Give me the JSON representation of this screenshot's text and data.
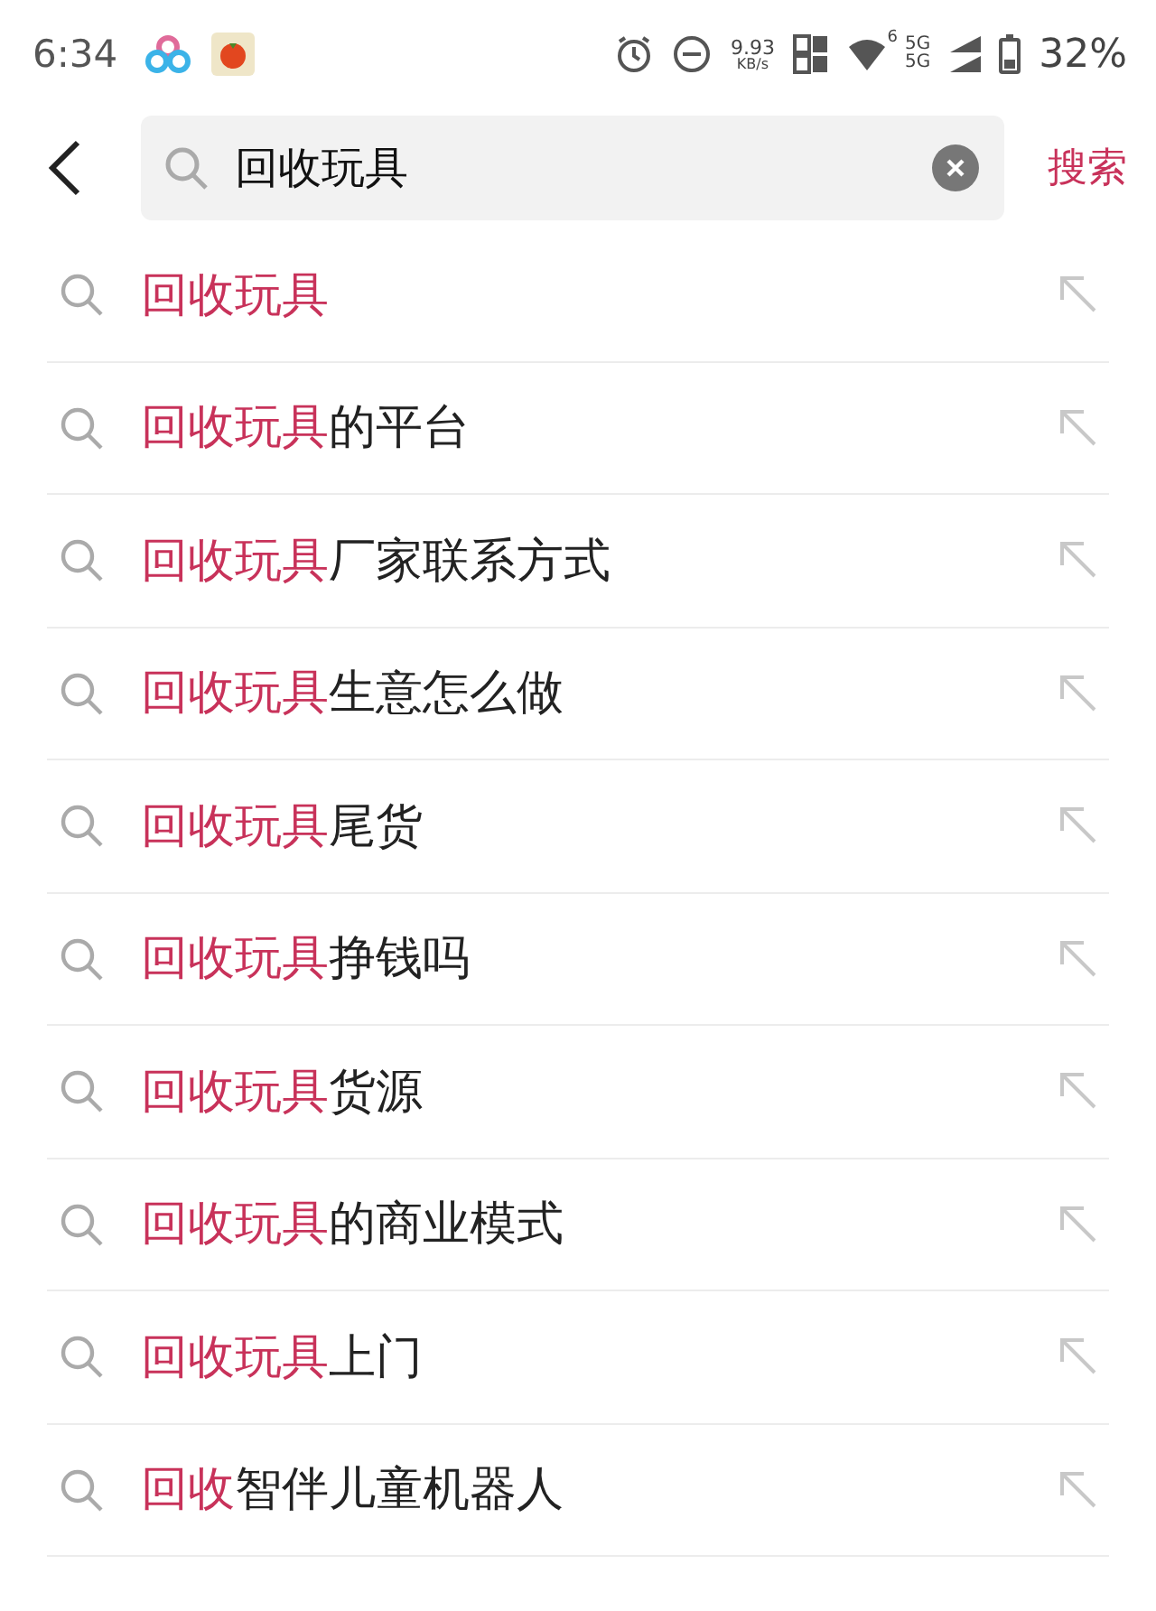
{
  "status_bar": {
    "time": "6:34",
    "speed_value": "9.93",
    "speed_unit": "KB/s",
    "wifi_badge": "6",
    "network_top": "5G",
    "network_bottom": "5G",
    "battery": "32%"
  },
  "search_bar": {
    "query": "回收玩具",
    "submit": "搜索"
  },
  "suggestions": [
    {
      "match": "回收玩具"
    },
    {
      "match": "回收玩具",
      "rest": "的平台"
    },
    {
      "match": "回收玩具",
      "rest": "厂家联系方式"
    },
    {
      "match": "回收玩具",
      "rest": "生意怎么做"
    },
    {
      "match": "回收玩具",
      "rest": "尾货"
    },
    {
      "match": "回收玩具",
      "rest": "挣钱吗"
    },
    {
      "match": "回收玩具",
      "rest": "货源"
    },
    {
      "match": "回收玩具",
      "rest": "的商业模式"
    },
    {
      "match": "回收玩具",
      "rest": "上门"
    },
    {
      "match": "回收",
      "rest": "智伴儿童机器人"
    }
  ]
}
